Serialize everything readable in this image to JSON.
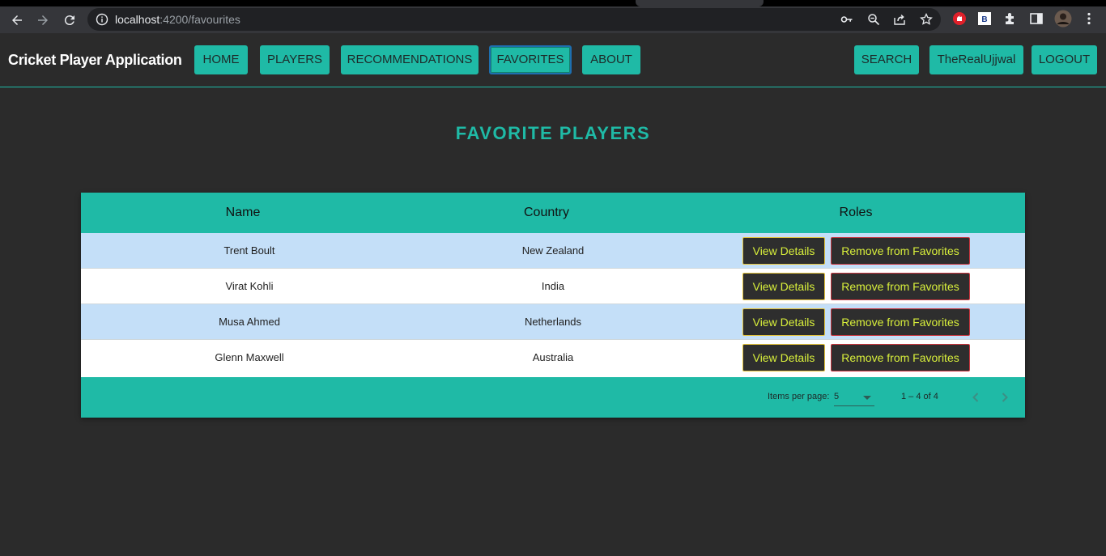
{
  "browser": {
    "url_host": "localhost",
    "url_path": ":4200/favourites"
  },
  "navbar": {
    "brand": "Cricket Player Application",
    "items": [
      {
        "label": "HOME"
      },
      {
        "label": "PLAYERS"
      },
      {
        "label": "RECOMMENDATIONS"
      },
      {
        "label": "FAVORITES",
        "active": true
      },
      {
        "label": "ABOUT"
      }
    ],
    "right_items": [
      {
        "label": "SEARCH"
      },
      {
        "label": "TheRealUjjwal"
      },
      {
        "label": "LOGOUT"
      }
    ]
  },
  "page": {
    "title": "FAVORITE PLAYERS"
  },
  "table": {
    "headers": [
      "Name",
      "Country",
      "Roles"
    ],
    "rows": [
      {
        "name": "Trent Boult",
        "country": "New Zealand",
        "view_label": "View Details",
        "remove_label": "Remove from Favorites"
      },
      {
        "name": "Virat Kohli",
        "country": "India",
        "view_label": "View Details",
        "remove_label": "Remove from Favorites"
      },
      {
        "name": "Musa Ahmed",
        "country": "Netherlands",
        "view_label": "View Details",
        "remove_label": "Remove from Favorites"
      },
      {
        "name": "Glenn Maxwell",
        "country": "Australia",
        "view_label": "View Details",
        "remove_label": "Remove from Favorites"
      }
    ],
    "paginator": {
      "items_per_page_label": "Items per page:",
      "items_per_page": "5",
      "range_label": "1 – 4 of 4"
    }
  },
  "colors": {
    "accent": "#1fbaa6",
    "background": "#2b2b2b",
    "row_highlight": "#c4dff8",
    "button_text": "#d8ef3b"
  }
}
